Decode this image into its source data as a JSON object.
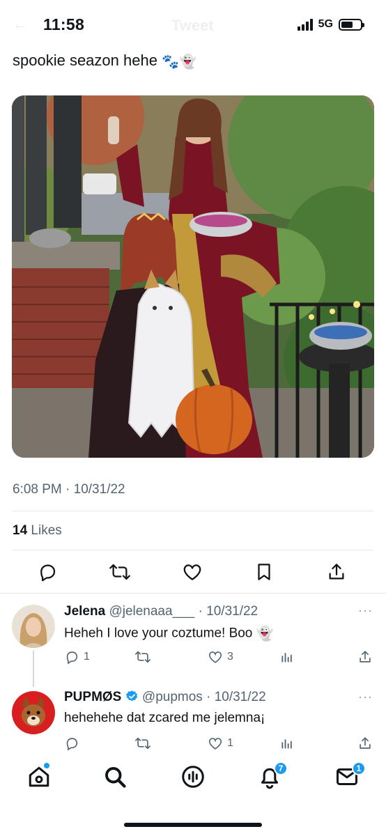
{
  "status_bar": {
    "time": "11:58",
    "network": "5G",
    "header_back": "←",
    "header_title": "Tweet"
  },
  "tweet": {
    "text": "spookie seazon hehe",
    "emojis": [
      "🐾",
      "👻"
    ],
    "timestamp": "6:08 PM · 10/31/22",
    "likes_count": "14",
    "likes_label": "Likes",
    "image_alt": "Halloween porch photo: woman in a red velvet gown holding a wine glass and a candy bowl, girl with a tiara, a dog dressed as a ghost, and a pumpkin"
  },
  "actions": {
    "icons": [
      "reply-icon",
      "retweet-icon",
      "like-icon",
      "bookmark-icon",
      "share-icon"
    ]
  },
  "replies": [
    {
      "name": "Jelena",
      "handle": "@jelenaaa___",
      "date": "· 10/31/22",
      "text": "Heheh I love your coztume! Boo",
      "emoji": "👻",
      "reply_count": "1",
      "retweet_count": "",
      "like_count": "3",
      "more": "···"
    },
    {
      "name": "PUPMØS",
      "handle": "@pupmos",
      "date": "· 10/31/22",
      "text": "hehehehe dat zcared me jelemna¡",
      "verified": true,
      "reply_count": "",
      "retweet_count": "",
      "like_count": "1",
      "more": "···"
    }
  ],
  "tab_bar": {
    "notifications_badge": "7",
    "messages_badge": "1"
  },
  "colors": {
    "accent": "#1d9bf0",
    "text": "#0f1419",
    "secondary": "#536471"
  }
}
